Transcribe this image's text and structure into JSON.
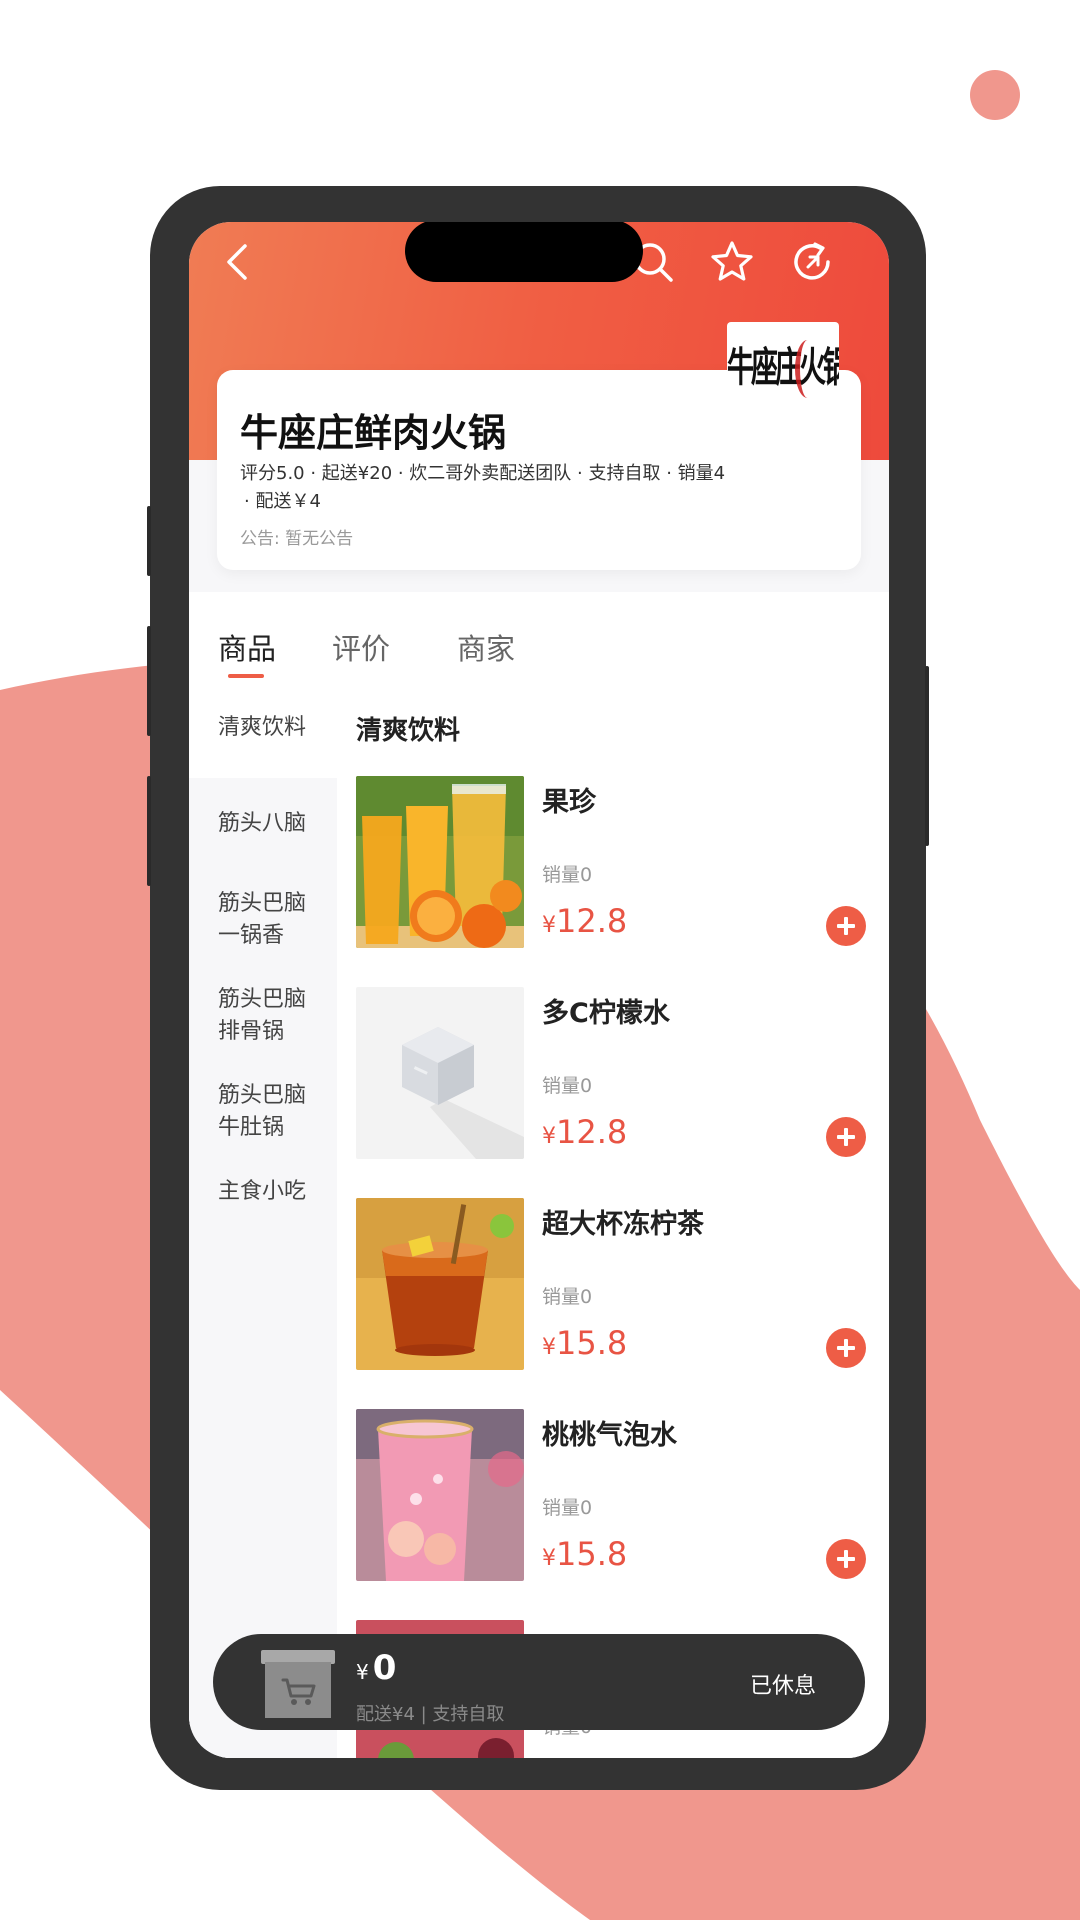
{
  "header": {
    "back_icon": "chevron-left-icon",
    "search_icon": "search-icon",
    "favorite_icon": "star-icon",
    "share_icon": "share-icon"
  },
  "shop": {
    "logo_text": "牛座庄火锅",
    "name": "牛座庄鲜肉火锅",
    "meta_line1": "评分5.0 · 起送¥20 · 炊二哥外卖配送团队 · 支持自取 · 销量4",
    "meta_line2": "· 配送￥4",
    "notice": "公告:  暂无公告"
  },
  "tabs": [
    {
      "label": "商品",
      "active": true
    },
    {
      "label": "评价",
      "active": false
    },
    {
      "label": "商家",
      "active": false
    }
  ],
  "categories": [
    {
      "label": "清爽饮料",
      "active": true
    },
    {
      "label": "筋头八脑",
      "active": false
    },
    {
      "label": "筋头巴脑一锅香",
      "active": false
    },
    {
      "label": "筋头巴脑排骨锅",
      "active": false
    },
    {
      "label": "筋头巴脑牛肚锅",
      "active": false
    },
    {
      "label": "主食小吃",
      "active": false
    }
  ],
  "section_title": "清爽饮料",
  "products": [
    {
      "name": "果珍",
      "sales": "销量0",
      "currency": "¥",
      "price": "12.8",
      "image": "orange-juice"
    },
    {
      "name": "多C柠檬水",
      "sales": "销量0",
      "currency": "¥",
      "price": "12.8",
      "image": "placeholder-box"
    },
    {
      "name": "超大杯冻柠茶",
      "sales": "销量0",
      "currency": "¥",
      "price": "15.8",
      "image": "iced-lemon-tea"
    },
    {
      "name": "桃桃气泡水",
      "sales": "销量0",
      "currency": "¥",
      "price": "15.8",
      "image": "peach-soda"
    },
    {
      "name": "",
      "sales": "销量0",
      "currency": "",
      "price": "",
      "image": "partial-drink"
    }
  ],
  "cart": {
    "currency": "¥",
    "total": "0",
    "subtitle": "配送¥4 | 支持自取",
    "status": "已休息"
  },
  "colors": {
    "accent": "#ee5d46",
    "price": "#e85444",
    "background_wave": "#f0978d",
    "phone_frame": "#333333"
  }
}
